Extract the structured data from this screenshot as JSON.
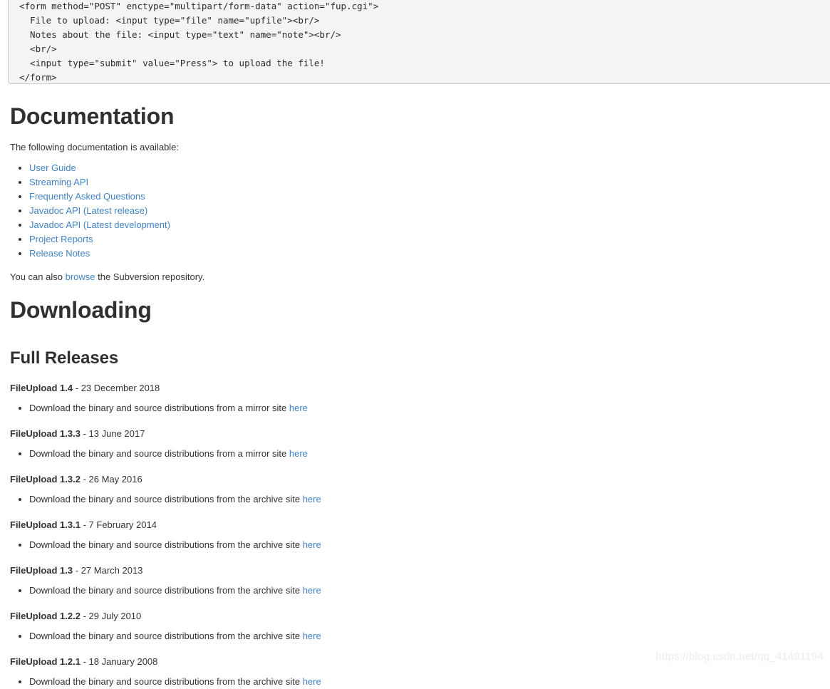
{
  "code_block": {
    "name": "html-form-example",
    "lines": [
      "<form method=\"POST\" enctype=\"multipart/form-data\" action=\"fup.cgi\">",
      "  File to upload: <input type=\"file\" name=\"upfile\"><br/>",
      "  Notes about the file: <input type=\"text\" name=\"note\"><br/>",
      "  <br/>",
      "  <input type=\"submit\" value=\"Press\"> to upload the file!",
      "</form>"
    ]
  },
  "documentation": {
    "heading": "Documentation",
    "intro": "The following documentation is available:",
    "links": [
      {
        "label": "User Guide"
      },
      {
        "label": "Streaming API"
      },
      {
        "label": "Frequently Asked Questions"
      },
      {
        "label": "Javadoc API (Latest release)"
      },
      {
        "label": "Javadoc API (Latest development)"
      },
      {
        "label": "Project Reports"
      },
      {
        "label": "Release Notes"
      }
    ],
    "svn_note": {
      "prefix": "You can also ",
      "link_label": "browse",
      "suffix": " the Subversion repository."
    }
  },
  "downloading": {
    "heading": "Downloading",
    "subheading": "Full Releases",
    "releases": [
      {
        "name": "FileUpload 1.4",
        "date": " - 23 December 2018",
        "download_prefix": "Download the binary and source distributions from a mirror site ",
        "download_link": "here"
      },
      {
        "name": "FileUpload 1.3.3",
        "date": " - 13 June 2017",
        "download_prefix": "Download the binary and source distributions from a mirror site ",
        "download_link": "here"
      },
      {
        "name": "FileUpload 1.3.2",
        "date": " - 26 May 2016",
        "download_prefix": "Download the binary and source distributions from the archive site ",
        "download_link": "here"
      },
      {
        "name": "FileUpload 1.3.1",
        "date": " - 7 February 2014",
        "download_prefix": "Download the binary and source distributions from the archive site ",
        "download_link": "here"
      },
      {
        "name": "FileUpload 1.3",
        "date": " - 27 March 2013",
        "download_prefix": "Download the binary and source distributions from the archive site ",
        "download_link": "here"
      },
      {
        "name": "FileUpload 1.2.2",
        "date": " - 29 July 2010",
        "download_prefix": "Download the binary and source distributions from the archive site ",
        "download_link": "here"
      },
      {
        "name": "FileUpload 1.2.1",
        "date": " - 18 January 2008",
        "download_prefix": "Download the binary and source distributions from the archive site ",
        "download_link": "here"
      }
    ]
  },
  "watermark": {
    "text": "https://blog.csdn.net/qq_41491194"
  },
  "colors": {
    "link": "#4183c4",
    "heading": "#303030",
    "body": "#333333",
    "code_bg": "#f4f4f4",
    "code_border": "#cccccc",
    "watermark": "#ececec"
  }
}
